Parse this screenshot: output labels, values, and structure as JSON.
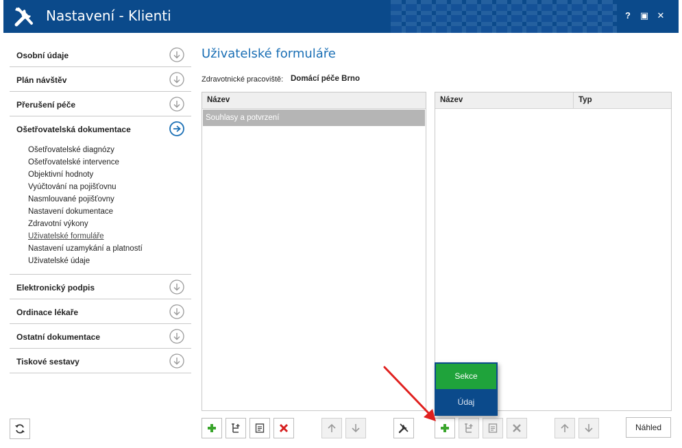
{
  "window": {
    "title": "Nastavení - Klienti",
    "help_label": "?",
    "maximize_label": "▣",
    "close_label": "✕"
  },
  "sidebar": {
    "sections_top": [
      {
        "label": "Osobní údaje"
      },
      {
        "label": "Plán návštěv"
      },
      {
        "label": "Přerušení péče"
      }
    ],
    "open_section": {
      "label": "Ošetřovatelská dokumentace",
      "items": [
        {
          "label": "Ošetřovatelské diagnózy"
        },
        {
          "label": "Ošetřovatelské intervence"
        },
        {
          "label": "Objektivní hodnoty"
        },
        {
          "label": "Vyúčtování na pojišťovnu"
        },
        {
          "label": "Nasmlouvané pojišťovny"
        },
        {
          "label": "Nastavení dokumentace"
        },
        {
          "label": "Zdravotní výkony"
        },
        {
          "label": "Uživatelské formuláře"
        },
        {
          "label": "Nastavení uzamykání a platností"
        },
        {
          "label": "Uživatelské údaje"
        }
      ],
      "active_item": "Uživatelské formuláře"
    },
    "sections_bottom": [
      {
        "label": "Elektronický podpis"
      },
      {
        "label": "Ordinace lékaře"
      },
      {
        "label": "Ostatní dokumentace"
      },
      {
        "label": "Tiskové sestavy"
      }
    ]
  },
  "main": {
    "title": "Uživatelské formuláře",
    "workplace_label": "Zdravotnické pracoviště:",
    "workplace_value": "Domácí péče Brno",
    "forms_grid": {
      "header_name": "Název",
      "rows": [
        {
          "name": "Souhlasy a potvrzení"
        }
      ]
    },
    "items_grid": {
      "header_name": "Název",
      "header_type": "Typ",
      "rows": []
    },
    "preview_label": "Náhled",
    "dropdown": {
      "options": [
        {
          "label": "Sekce"
        },
        {
          "label": "Údaj"
        }
      ]
    }
  },
  "colors": {
    "titlebar": "#0b4a8b",
    "accent_blue": "#1a6fb5",
    "add_green": "#3aa52c",
    "delete_red": "#d61f1f",
    "menu_highlight": "#1fa33b",
    "selected_row": "#b5b5b5"
  },
  "icons": {
    "app": "wrench-screwdriver-icon",
    "section_collapsed": "chevron-down-circle-icon",
    "section_open": "arrow-right-circle-icon",
    "refresh": "refresh-icon",
    "add": "plus-icon",
    "add_sub": "add-child-icon",
    "edit": "edit-icon",
    "delete": "delete-icon",
    "up": "arrow-up-icon",
    "down": "arrow-down-icon",
    "settings": "wrench-screwdriver-icon"
  }
}
